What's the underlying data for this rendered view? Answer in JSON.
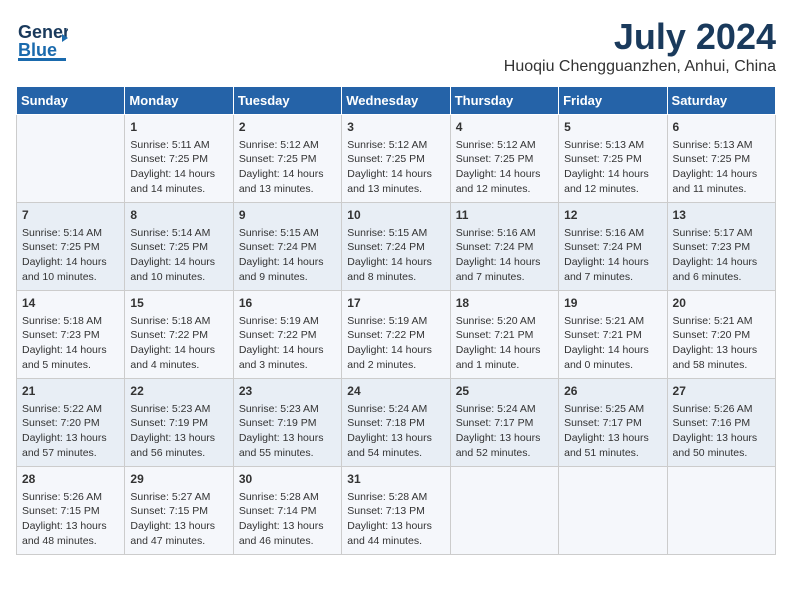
{
  "header": {
    "logo_general": "General",
    "logo_blue": "Blue",
    "month": "July 2024",
    "location": "Huoqiu Chengguanzhen, Anhui, China"
  },
  "days_of_week": [
    "Sunday",
    "Monday",
    "Tuesday",
    "Wednesday",
    "Thursday",
    "Friday",
    "Saturday"
  ],
  "weeks": [
    [
      {
        "day": "",
        "info": ""
      },
      {
        "day": "1",
        "info": "Sunrise: 5:11 AM\nSunset: 7:25 PM\nDaylight: 14 hours\nand 14 minutes."
      },
      {
        "day": "2",
        "info": "Sunrise: 5:12 AM\nSunset: 7:25 PM\nDaylight: 14 hours\nand 13 minutes."
      },
      {
        "day": "3",
        "info": "Sunrise: 5:12 AM\nSunset: 7:25 PM\nDaylight: 14 hours\nand 13 minutes."
      },
      {
        "day": "4",
        "info": "Sunrise: 5:12 AM\nSunset: 7:25 PM\nDaylight: 14 hours\nand 12 minutes."
      },
      {
        "day": "5",
        "info": "Sunrise: 5:13 AM\nSunset: 7:25 PM\nDaylight: 14 hours\nand 12 minutes."
      },
      {
        "day": "6",
        "info": "Sunrise: 5:13 AM\nSunset: 7:25 PM\nDaylight: 14 hours\nand 11 minutes."
      }
    ],
    [
      {
        "day": "7",
        "info": "Sunrise: 5:14 AM\nSunset: 7:25 PM\nDaylight: 14 hours\nand 10 minutes."
      },
      {
        "day": "8",
        "info": "Sunrise: 5:14 AM\nSunset: 7:25 PM\nDaylight: 14 hours\nand 10 minutes."
      },
      {
        "day": "9",
        "info": "Sunrise: 5:15 AM\nSunset: 7:24 PM\nDaylight: 14 hours\nand 9 minutes."
      },
      {
        "day": "10",
        "info": "Sunrise: 5:15 AM\nSunset: 7:24 PM\nDaylight: 14 hours\nand 8 minutes."
      },
      {
        "day": "11",
        "info": "Sunrise: 5:16 AM\nSunset: 7:24 PM\nDaylight: 14 hours\nand 7 minutes."
      },
      {
        "day": "12",
        "info": "Sunrise: 5:16 AM\nSunset: 7:24 PM\nDaylight: 14 hours\nand 7 minutes."
      },
      {
        "day": "13",
        "info": "Sunrise: 5:17 AM\nSunset: 7:23 PM\nDaylight: 14 hours\nand 6 minutes."
      }
    ],
    [
      {
        "day": "14",
        "info": "Sunrise: 5:18 AM\nSunset: 7:23 PM\nDaylight: 14 hours\nand 5 minutes."
      },
      {
        "day": "15",
        "info": "Sunrise: 5:18 AM\nSunset: 7:22 PM\nDaylight: 14 hours\nand 4 minutes."
      },
      {
        "day": "16",
        "info": "Sunrise: 5:19 AM\nSunset: 7:22 PM\nDaylight: 14 hours\nand 3 minutes."
      },
      {
        "day": "17",
        "info": "Sunrise: 5:19 AM\nSunset: 7:22 PM\nDaylight: 14 hours\nand 2 minutes."
      },
      {
        "day": "18",
        "info": "Sunrise: 5:20 AM\nSunset: 7:21 PM\nDaylight: 14 hours\nand 1 minute."
      },
      {
        "day": "19",
        "info": "Sunrise: 5:21 AM\nSunset: 7:21 PM\nDaylight: 14 hours\nand 0 minutes."
      },
      {
        "day": "20",
        "info": "Sunrise: 5:21 AM\nSunset: 7:20 PM\nDaylight: 13 hours\nand 58 minutes."
      }
    ],
    [
      {
        "day": "21",
        "info": "Sunrise: 5:22 AM\nSunset: 7:20 PM\nDaylight: 13 hours\nand 57 minutes."
      },
      {
        "day": "22",
        "info": "Sunrise: 5:23 AM\nSunset: 7:19 PM\nDaylight: 13 hours\nand 56 minutes."
      },
      {
        "day": "23",
        "info": "Sunrise: 5:23 AM\nSunset: 7:19 PM\nDaylight: 13 hours\nand 55 minutes."
      },
      {
        "day": "24",
        "info": "Sunrise: 5:24 AM\nSunset: 7:18 PM\nDaylight: 13 hours\nand 54 minutes."
      },
      {
        "day": "25",
        "info": "Sunrise: 5:24 AM\nSunset: 7:17 PM\nDaylight: 13 hours\nand 52 minutes."
      },
      {
        "day": "26",
        "info": "Sunrise: 5:25 AM\nSunset: 7:17 PM\nDaylight: 13 hours\nand 51 minutes."
      },
      {
        "day": "27",
        "info": "Sunrise: 5:26 AM\nSunset: 7:16 PM\nDaylight: 13 hours\nand 50 minutes."
      }
    ],
    [
      {
        "day": "28",
        "info": "Sunrise: 5:26 AM\nSunset: 7:15 PM\nDaylight: 13 hours\nand 48 minutes."
      },
      {
        "day": "29",
        "info": "Sunrise: 5:27 AM\nSunset: 7:15 PM\nDaylight: 13 hours\nand 47 minutes."
      },
      {
        "day": "30",
        "info": "Sunrise: 5:28 AM\nSunset: 7:14 PM\nDaylight: 13 hours\nand 46 minutes."
      },
      {
        "day": "31",
        "info": "Sunrise: 5:28 AM\nSunset: 7:13 PM\nDaylight: 13 hours\nand 44 minutes."
      },
      {
        "day": "",
        "info": ""
      },
      {
        "day": "",
        "info": ""
      },
      {
        "day": "",
        "info": ""
      }
    ]
  ]
}
